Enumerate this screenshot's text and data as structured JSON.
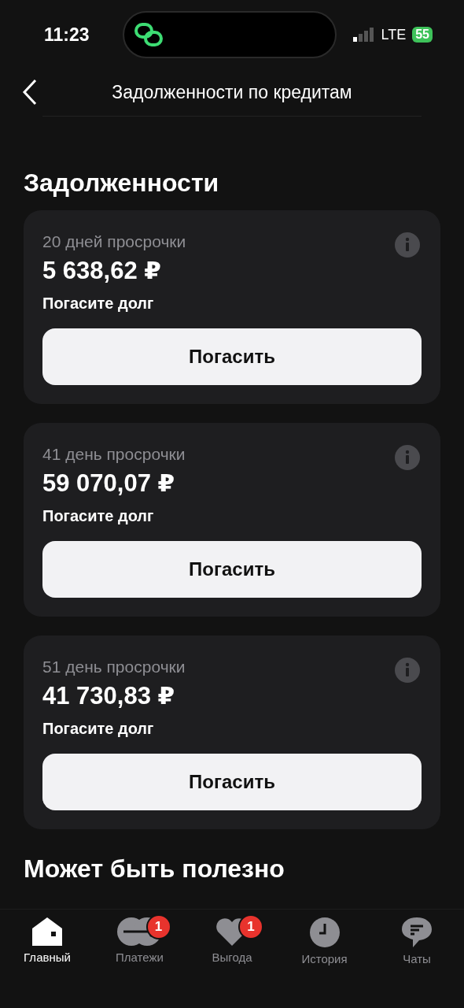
{
  "status_bar": {
    "time": "11:23",
    "network": "LTE",
    "battery": "55"
  },
  "header": {
    "title": "Задолженности по кредитам"
  },
  "section_title": "Задолженности",
  "debts": [
    {
      "overdue": "20 дней просрочки",
      "amount": "5 638,62 ₽",
      "note": "Погасите долг",
      "button": "Погасить"
    },
    {
      "overdue": "41 день просрочки",
      "amount": "59 070,07 ₽",
      "note": "Погасите долг",
      "button": "Погасить"
    },
    {
      "overdue": "51 день просрочки",
      "amount": "41 730,83 ₽",
      "note": "Погасите долг",
      "button": "Погасить"
    }
  ],
  "next_section_title": "Может быть полезно",
  "tab_bar": [
    {
      "kind": "home",
      "label": "Главный",
      "selected": true
    },
    {
      "kind": "payments",
      "label": "Платежи",
      "selected": false,
      "badge": "1"
    },
    {
      "kind": "benefits",
      "label": "Выгода",
      "selected": false,
      "badge": "1"
    },
    {
      "kind": "history",
      "label": "История",
      "selected": false
    },
    {
      "kind": "chats",
      "label": "Чаты",
      "selected": false
    }
  ]
}
